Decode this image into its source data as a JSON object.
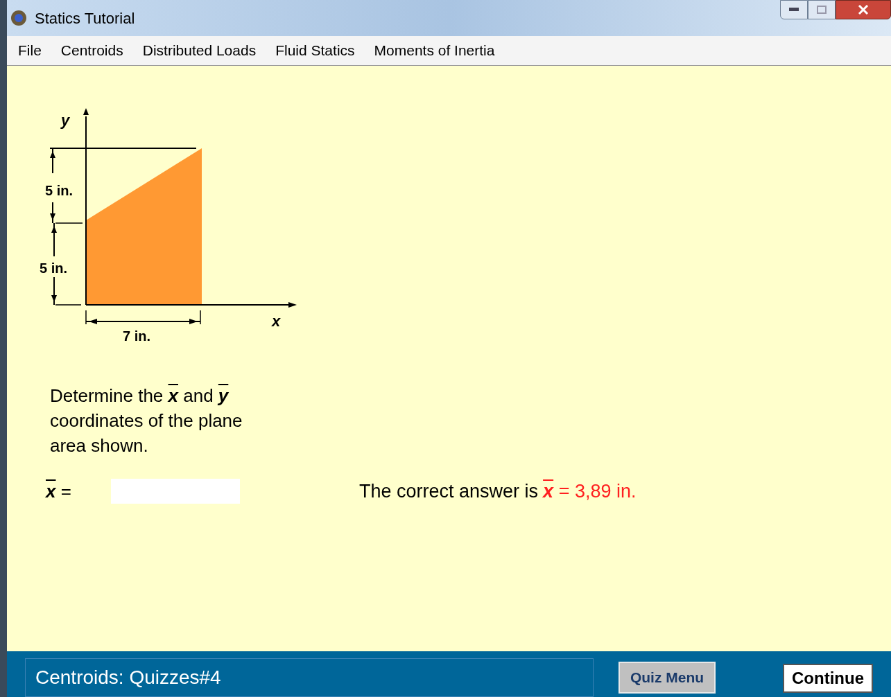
{
  "window": {
    "title": "Statics Tutorial"
  },
  "menu": [
    "File",
    "Centroids",
    "Distributed Loads",
    "Fluid Statics",
    "Moments of Inertia"
  ],
  "figure": {
    "y_axis": "y",
    "x_axis": "x",
    "dim_upper": "5 in.",
    "dim_lower": "5 in.",
    "dim_width": "7 in."
  },
  "question": "Determine the **x** and **y** coordinates of the plane area shown.",
  "answer_field": {
    "label": "**x** ="
  },
  "feedback": {
    "label": "The correct answer is",
    "value": "**x** = 3,89 in."
  },
  "status_bar": {
    "text": "Centroids: Quizzes#4",
    "buttons": [
      "Quiz Menu",
      "Continue"
    ]
  }
}
